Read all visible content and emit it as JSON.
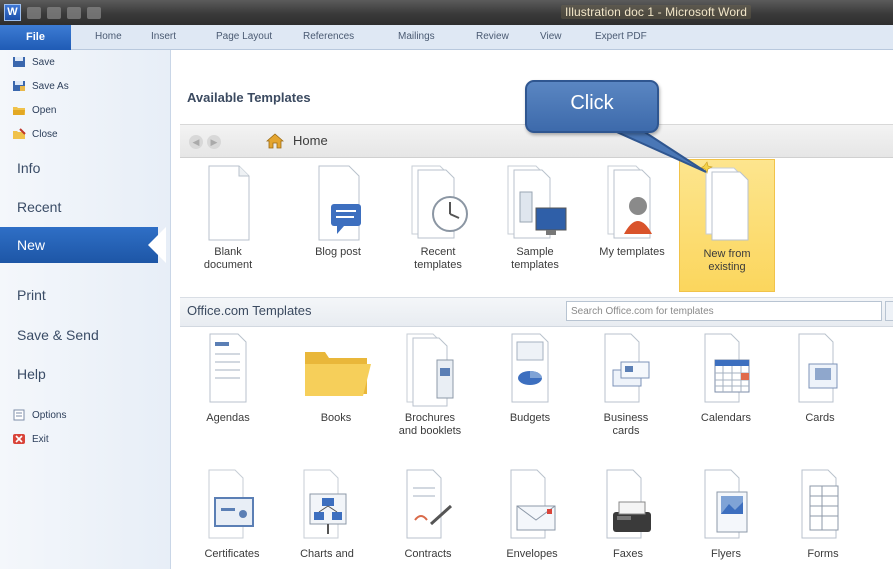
{
  "window": {
    "title": "Illustration doc 1 - Microsoft Word",
    "app_letter": "W"
  },
  "ribbon": {
    "tabs": [
      "File",
      "Home",
      "Insert",
      "Page Layout",
      "References",
      "Mailings",
      "Review",
      "View",
      "Expert PDF"
    ]
  },
  "backstage": {
    "small_top": [
      "Save",
      "Save As",
      "Open",
      "Close"
    ],
    "big": [
      "Info",
      "Recent",
      "New",
      "Print",
      "Save & Send",
      "Help"
    ],
    "small_bottom": [
      "Options",
      "Exit"
    ],
    "selected": "New"
  },
  "main": {
    "heading": "Available Templates",
    "nav_home": "Home",
    "templates": [
      {
        "line1": "Blank",
        "line2": "document",
        "icon": "blank-document-icon"
      },
      {
        "line1": "Blog post",
        "line2": "",
        "icon": "blog-post-icon"
      },
      {
        "line1": "Recent",
        "line2": "templates",
        "icon": "recent-templates-icon"
      },
      {
        "line1": "Sample",
        "line2": "templates",
        "icon": "sample-templates-icon"
      },
      {
        "line1": "My templates",
        "line2": "",
        "icon": "my-templates-icon"
      },
      {
        "line1": "New from",
        "line2": "existing",
        "icon": "new-from-existing-icon"
      }
    ],
    "office_title": "Office.com Templates",
    "search_placeholder": "Search Office.com for templates",
    "office_row1": [
      {
        "line1": "Agendas",
        "line2": ""
      },
      {
        "line1": "Books",
        "line2": ""
      },
      {
        "line1": "Brochures",
        "line2": "and booklets"
      },
      {
        "line1": "Budgets",
        "line2": ""
      },
      {
        "line1": "Business",
        "line2": "cards"
      },
      {
        "line1": "Calendars",
        "line2": ""
      },
      {
        "line1": "Cards",
        "line2": ""
      }
    ],
    "office_row2": [
      {
        "line1": "Certificates",
        "line2": ""
      },
      {
        "line1": "Charts and",
        "line2": ""
      },
      {
        "line1": "Contracts",
        "line2": ""
      },
      {
        "line1": "Envelopes",
        "line2": ""
      },
      {
        "line1": "Faxes",
        "line2": ""
      },
      {
        "line1": "Flyers",
        "line2": ""
      },
      {
        "line1": "Forms",
        "line2": ""
      }
    ]
  },
  "callout": {
    "text": "Click"
  },
  "colors": {
    "accent": "#1f5bb5",
    "selected_tile": "#fbd65d",
    "callout": "#4a77b6"
  }
}
